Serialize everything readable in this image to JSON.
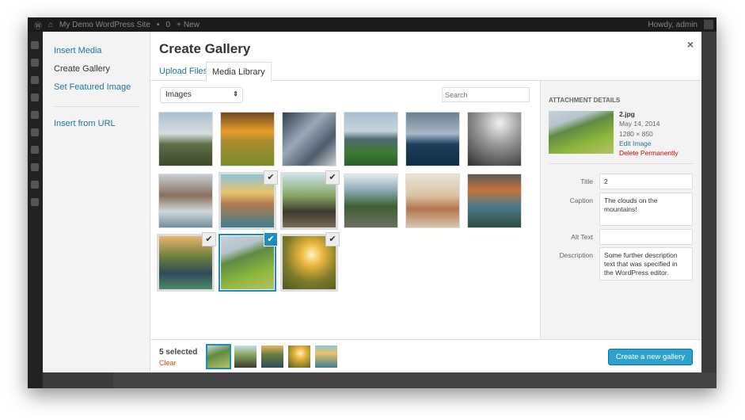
{
  "adminbar": {
    "site": "My Demo WordPress Site",
    "comments": "0",
    "new": "New",
    "howdy": "Howdy, admin"
  },
  "menu": {
    "items": [
      {
        "label": "Insert Media"
      },
      {
        "label": "Create Gallery"
      },
      {
        "label": "Set Featured Image"
      }
    ],
    "url": "Insert from URL"
  },
  "modal": {
    "title": "Create Gallery",
    "close": "×"
  },
  "tabs": [
    {
      "label": "Upload Files"
    },
    {
      "label": "Media Library"
    }
  ],
  "toolbar": {
    "filter": "Images",
    "search_placeholder": "Search"
  },
  "grid": [
    {
      "bg": "linear-gradient(180deg,#a9bfd0 0%,#d6dde0 40%,#5e6e44 60%,#3d4a2a 100%)",
      "state": ""
    },
    {
      "bg": "linear-gradient(180deg,#6b4a22 0%,#e99b2a 35%,#a78c2f 55%,#7d8a2a 100%)",
      "state": ""
    },
    {
      "bg": "linear-gradient(135deg,#2f3f50 0%,#9aa9b6 40%,#4e5d6c 70%,#c9ced2 100%)",
      "state": ""
    },
    {
      "bg": "linear-gradient(180deg,#a7bed0 0%,#c7d4dd 35%,#506a74 50%,#3d7a34 75%,#2f5f2a 100%)",
      "state": ""
    },
    {
      "bg": "linear-gradient(180deg,#6a7f92 0%,#a7b8c6 40%,#1c3f5e 60%,#0f2d45 100%)",
      "state": ""
    },
    {
      "bg": "radial-gradient(circle at 60% 20%,#f2f2f2 0%,#9a9a9a 40%,#2e2e2e 100%)",
      "state": ""
    },
    {
      "bg": "linear-gradient(180deg,#c6cfd4 0%,#8a6f5e 40%,#cfd7da 70%,#6f8ea0 100%)",
      "state": ""
    },
    {
      "bg": "linear-gradient(180deg,#8ec4d6 0%,#e8c56c 35%,#b37c4f 55%,#3e7d8f 100%)",
      "state": "sel"
    },
    {
      "bg": "linear-gradient(180deg,#c9dfe9 0%,#87a763 40%,#3e3a2e 70%,#7a6a55 100%)",
      "state": "sel"
    },
    {
      "bg": "linear-gradient(180deg,#e4eaee 0%,#8aa9b6 30%,#3e5f33 60%,#6d6f63 100%)",
      "state": ""
    },
    {
      "bg": "linear-gradient(180deg,#ece2d4 0%,#d9c3a4 40%,#b4744f 65%,#d8c8b0 100%)",
      "state": ""
    },
    {
      "bg": "linear-gradient(180deg,#5b5b5b 0%,#c4723a 30%,#4b7b8e 60%,#2b4f3f 100%)",
      "state": ""
    },
    {
      "bg": "linear-gradient(180deg,#e8b56d 0%,#6a7d3d 40%,#2f4b5c 70%,#4e8a66 100%)",
      "state": "sel"
    },
    {
      "bg": "linear-gradient(160deg,#c7d3db 0%,#b6c4c9 25%,#5f8a44 40%,#8db83b 70%,#b6c26a 100%)",
      "state": "act"
    },
    {
      "bg": "radial-gradient(circle at 55% 35%,#fff5c0 0%,#e8b63c 25%,#7e7a2a 60%,#4e5a22 100%)",
      "state": "sel"
    }
  ],
  "details": {
    "heading": "ATTACHMENT DETAILS",
    "filename": "2.jpg",
    "date": "May 14, 2014",
    "dimensions": "1280 × 850",
    "edit": "Edit Image",
    "delete": "Delete Permanently",
    "title_label": "Title",
    "title": "2",
    "caption_label": "Caption",
    "caption": "The clouds on the mountains!",
    "alt_label": "Alt Text",
    "alt": "",
    "desc_label": "Description",
    "desc": "Some further description text that was specified in the WordPress editor."
  },
  "footer": {
    "count": "5 selected",
    "clear": "Clear",
    "button": "Create a new gallery",
    "selection": [
      "linear-gradient(160deg,#c7d3db 0%,#5f8a44 40%,#b6c26a 100%)",
      "linear-gradient(180deg,#c9dfe9 0%,#87a763 40%,#3e3a2e 100%)",
      "linear-gradient(180deg,#e8b56d 0%,#6a7d3d 40%,#2f4b5c 100%)",
      "radial-gradient(circle at 55% 35%,#fff5c0 0%,#e8b63c 30%,#4e5a22 100%)",
      "linear-gradient(180deg,#8ec4d6 0%,#e8c56c 35%,#3e7d8f 100%)"
    ]
  },
  "colors": {
    "accent": "#1e8cbe",
    "button": "#2ea2cc",
    "link": "#21759b",
    "danger": "#bc0b0b"
  }
}
